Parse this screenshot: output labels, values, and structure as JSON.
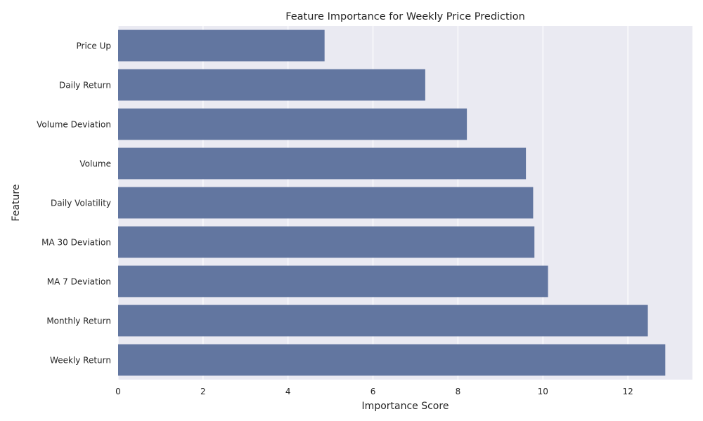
{
  "chart_data": {
    "type": "bar",
    "orientation": "horizontal",
    "title": "Feature Importance for Weekly Price Prediction",
    "xlabel": "Importance Score",
    "ylabel": "Feature",
    "categories": [
      "Price Up",
      "Daily Return",
      "Volume Deviation",
      "Volume",
      "Daily Volatility",
      "MA 30 Deviation",
      "MA 7 Deviation",
      "Monthly Return",
      "Weekly Return"
    ],
    "values": [
      4.86,
      7.23,
      8.21,
      9.6,
      9.77,
      9.8,
      10.12,
      12.47,
      12.88
    ],
    "xlim": [
      0,
      13.52
    ],
    "xticks": [
      0,
      2,
      4,
      6,
      8,
      10,
      12
    ],
    "xtick_labels": [
      "0",
      "2",
      "4",
      "6",
      "8",
      "10",
      "12"
    ],
    "grid": true,
    "colors": {
      "bar": "#6276a0",
      "background": "#eaeaf2",
      "grid": "#ffffff",
      "text": "#262626"
    }
  }
}
